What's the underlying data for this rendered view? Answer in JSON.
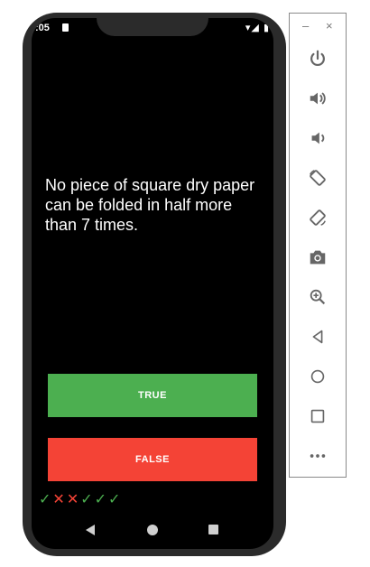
{
  "status_bar": {
    "time": ":05",
    "right_icons": "▾◢ ▮"
  },
  "quiz": {
    "question": "No piece of square dry paper can be folded in half more than 7 times.",
    "true_label": "TRUE",
    "false_label": "FALSE",
    "score_marks": [
      {
        "symbol": "✓",
        "result": "correct"
      },
      {
        "symbol": "✕",
        "result": "wrong"
      },
      {
        "symbol": "✕",
        "result": "wrong"
      },
      {
        "symbol": "✓",
        "result": "correct"
      },
      {
        "symbol": "✓",
        "result": "correct"
      },
      {
        "symbol": "✓",
        "result": "correct"
      }
    ]
  },
  "emulator_panel": {
    "minimize": "–",
    "close": "×",
    "buttons": [
      "power-icon",
      "volume-up-icon",
      "volume-down-icon",
      "rotate-left-icon",
      "rotate-right-icon",
      "camera-icon",
      "zoom-icon",
      "back-icon",
      "home-icon",
      "overview-icon",
      "more-icon"
    ]
  },
  "colors": {
    "true_button": "#4caf50",
    "false_button": "#f44336",
    "correct": "#4caf50",
    "wrong": "#f44336"
  }
}
